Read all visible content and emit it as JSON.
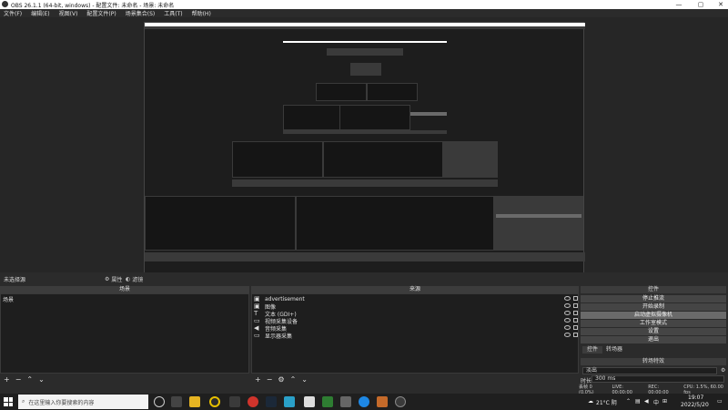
{
  "window": {
    "title": "OBS 26.1.1 (64-bit, windows) - 配置文件: 未命名 - 场景: 未命名",
    "min": "—",
    "max": "▢",
    "close": "✕"
  },
  "menu": [
    "文件(F)",
    "编辑(E)",
    "视图(V)",
    "配置文件(P)",
    "场景集合(S)",
    "工具(T)",
    "帮助(H)"
  ],
  "scene_bar": {
    "label": "未选择源",
    "properties": "属性",
    "filters": "滤镜"
  },
  "scenes": {
    "header": "场景",
    "items": [
      "场景"
    ]
  },
  "sources": {
    "header": "来源",
    "items": [
      {
        "label": "advertisement",
        "icon": "image-icon"
      },
      {
        "label": "图像",
        "icon": "image-icon"
      },
      {
        "label": "文本 (GDI+)",
        "icon": "text-icon"
      },
      {
        "label": "视频采集设备",
        "icon": "camera-icon"
      },
      {
        "label": "音频采集",
        "icon": "speaker-icon"
      },
      {
        "label": "显示器采集",
        "icon": "monitor-icon"
      }
    ]
  },
  "controls": {
    "header": "控件",
    "buttons": [
      "停止推流",
      "开始录制",
      "启动虚拟摄像机",
      "工作室模式",
      "设置",
      "退出"
    ]
  },
  "transitions": {
    "tab1": "控件",
    "tab2": "转场器",
    "header": "转场特效",
    "type": "淡出",
    "duration_label": "时长",
    "duration_value": "300 ms"
  },
  "status": {
    "dropped": "丢帧 0 (0.0%)",
    "live": "LIVE: 00:00:00",
    "rec": "REC: 00:00:00",
    "cpu": "CPU: 1.5%, 60.00 fps"
  },
  "taskbar": {
    "search_placeholder": "在这里输入你要搜索的内容",
    "weather": "21°C 阴",
    "lang": "中",
    "time": "19:07",
    "date": "2022/5/20"
  }
}
